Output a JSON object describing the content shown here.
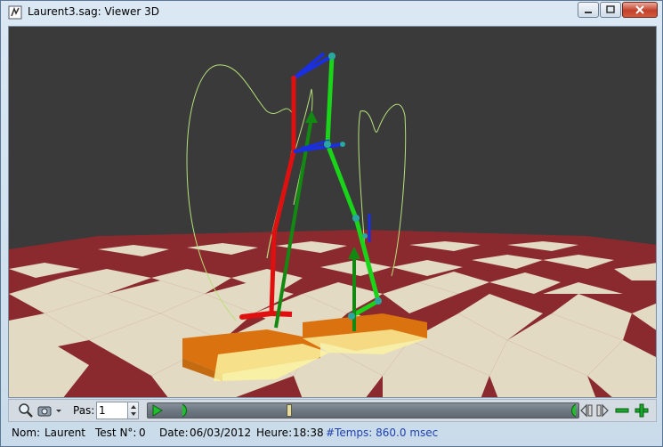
{
  "window": {
    "title": "Laurent3.sag: Viewer 3D"
  },
  "toolbar": {
    "pas_label": "Pas:",
    "pas_value": "1",
    "playback_progress": 0.26
  },
  "status": {
    "nom_label": "Nom:",
    "nom_value": "Laurent",
    "test_label": "Test N°:",
    "test_value": "0",
    "date_label": "Date:",
    "date_value": "06/03/2012",
    "heure_label": "Heure:",
    "heure_value": "18:38",
    "temps_text": "#Temps:  860.0 msec"
  },
  "colors": {
    "left_leg": "#e01010",
    "right_leg": "#19d419",
    "foot_link": "#1a2fe0",
    "floor_red": "#8b2a2e",
    "floor_light": "#e8e4cc",
    "background": "#3a3a3a",
    "temps_blue": "#2040b0"
  },
  "icons": [
    "app-icon",
    "zoom-icon",
    "camera-icon",
    "dropdown-arrow-icon",
    "play-icon",
    "step-back-icon",
    "step-forward-icon",
    "minus-icon",
    "plus-icon",
    "minimize-icon",
    "maximize-icon",
    "close-icon"
  ]
}
